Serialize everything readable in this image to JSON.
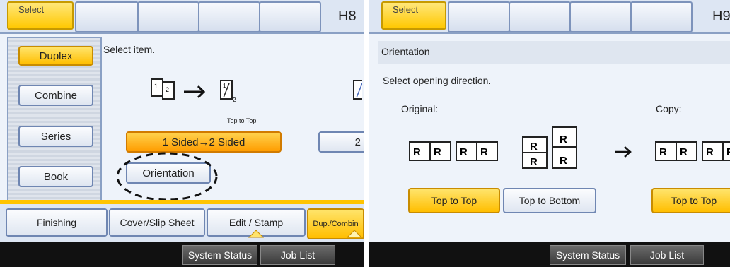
{
  "left": {
    "top_tab": "Select",
    "screen_id": "H8",
    "side_menu": [
      "Duplex",
      "Combine",
      "Series",
      "Book"
    ],
    "instruction": "Select item.",
    "preview_caption": "Top to Top",
    "mode_button": "1 Sided→2 Sided",
    "partial_button": "2",
    "orientation_button": "Orientation",
    "bottom_tabs": [
      "Finishing",
      "Cover/Slip Sheet",
      "Edit / Stamp",
      "Dup./Combin"
    ]
  },
  "right": {
    "top_tab": "Select",
    "screen_id": "H9",
    "header": "Orientation",
    "instruction": "Select opening direction.",
    "original_label": "Original:",
    "copy_label": "Copy:",
    "original_buttons": [
      "Top to Top",
      "Top to Bottom"
    ],
    "copy_button": "Top to Top",
    "page_letter": "R"
  },
  "status_bar": {
    "system_status": "System Status",
    "job_list": "Job List"
  },
  "colors": {
    "selected_yellow": "#ffc800",
    "accent_orange": "#ff9d00",
    "frame_blue": "#6f86b2"
  }
}
